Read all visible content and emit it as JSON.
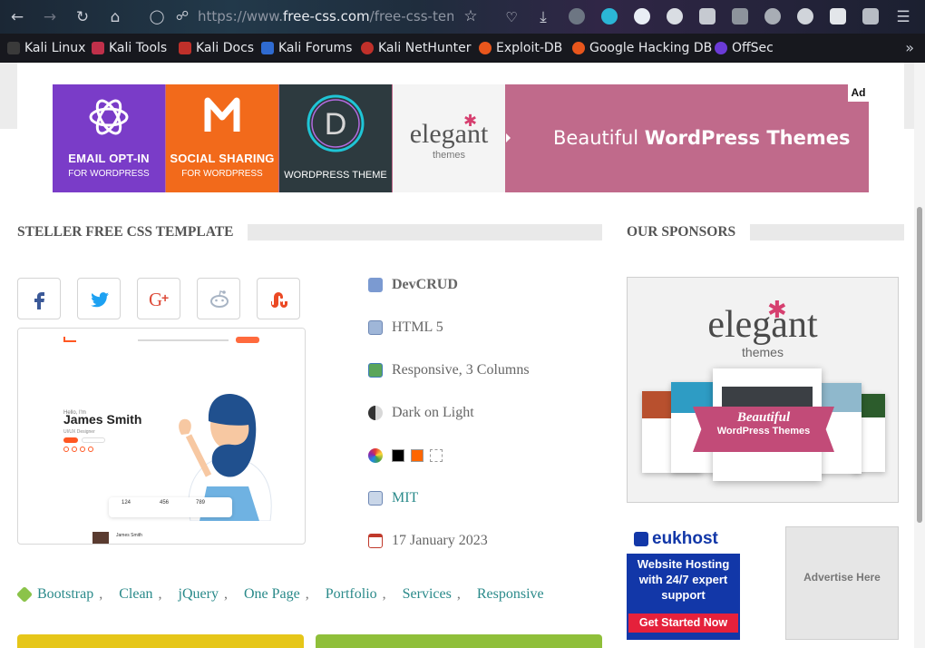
{
  "browser": {
    "url_prefix": "https://www.",
    "url_host": "free-css.com",
    "url_path": "/free-css-templates",
    "bookmarks": [
      {
        "label": "Kali Linux",
        "color": "#222222"
      },
      {
        "label": "Kali Tools",
        "color": "#c0304a"
      },
      {
        "label": "Kali Docs",
        "color": "#c0302a"
      },
      {
        "label": "Kali Forums",
        "color": "#2f6bd1"
      },
      {
        "label": "Kali NetHunter",
        "color": "#c0302a"
      },
      {
        "label": "Exploit-DB",
        "color": "#e8561c"
      },
      {
        "label": "Google Hacking DB",
        "color": "#e8561c"
      },
      {
        "label": "OffSec",
        "color": "#6b3bd6"
      }
    ]
  },
  "ad": {
    "tile1_big": "EMAIL OPT-IN",
    "tile1_small": "FOR WORDPRESS",
    "tile2_big": "SOCIAL SHARING",
    "tile2_small": "FOR WORDPRESS",
    "tile3_label": "WORDPRESS THEME",
    "tile4_word": "elegant",
    "tile4_sub": "themes",
    "tagline_plain": "Beautiful ",
    "tagline_bold": "WordPress Themes",
    "badge": "Ad"
  },
  "main": {
    "heading": "STELLER FREE CSS TEMPLATE",
    "preview_name": "James Smith",
    "preview_hello": "Hello, I'm",
    "preview_role": "UI/UX Designer",
    "preview_stats": [
      "124",
      "456",
      "789"
    ],
    "preview_footer_name": "James Smith",
    "meta": {
      "author": "DevCRUD",
      "html": "HTML 5",
      "layout": "Responsive, 3 Columns",
      "scheme": "Dark on Light",
      "colors": [
        "#000000",
        "#ff6600",
        "#ffffff"
      ],
      "license": "MIT",
      "date": "17 January 2023"
    },
    "tags": [
      "Bootstrap",
      "Clean",
      "jQuery",
      "One Page",
      "Portfolio",
      "Services",
      "Responsive"
    ]
  },
  "sidebar": {
    "heading": "OUR SPONSORS",
    "elegant_word": "elegant",
    "elegant_sub": "themes",
    "elegant_ribbon1": "Beautiful",
    "elegant_ribbon2": "WordPress Themes",
    "eukhost_logo": "eukhost",
    "eukhost_text": "Website Hosting with 24/7 expert support",
    "eukhost_cta": "Get Started Now",
    "advertise": "Advertise Here"
  }
}
